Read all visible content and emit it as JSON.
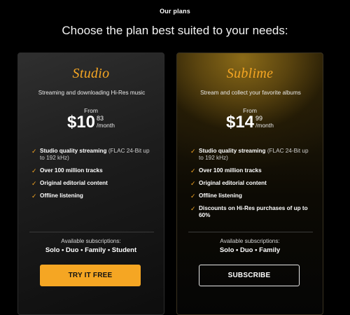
{
  "header": {
    "eyebrow": "Our plans",
    "headline": "Choose the plan best suited to your needs:"
  },
  "plans": [
    {
      "name": "Studio",
      "description": "Streaming and downloading Hi-Res music",
      "from_label": "From",
      "price_currency": "$",
      "price_whole": "$10",
      "price_cents": "83",
      "price_period": "/month",
      "features": [
        {
          "bold": "Studio quality streaming",
          "detail": " (FLAC 24-Bit up to 192 kHz)"
        },
        {
          "bold": "Over 100 million tracks",
          "detail": ""
        },
        {
          "bold": "Original editorial content",
          "detail": ""
        },
        {
          "bold": "Offline listening",
          "detail": ""
        }
      ],
      "available_label": "Available subscriptions:",
      "subscriptions": "Solo • Duo • Family • Student",
      "cta_label": "TRY IT FREE"
    },
    {
      "name": "Sublime",
      "description": "Stream and collect your favorite albums",
      "from_label": "From",
      "price_currency": "$",
      "price_whole": "$14",
      "price_cents": "99",
      "price_period": "/month",
      "features": [
        {
          "bold": "Studio quality streaming",
          "detail": " (FLAC 24-Bit up to 192 kHz)"
        },
        {
          "bold": "Over 100 million tracks",
          "detail": ""
        },
        {
          "bold": "Original editorial content",
          "detail": ""
        },
        {
          "bold": "Offline listening",
          "detail": ""
        },
        {
          "bold": "Discounts on Hi-Res purchases of up to 60%",
          "detail": ""
        }
      ],
      "available_label": "Available subscriptions:",
      "subscriptions": "Solo • Duo • Family",
      "cta_label": "SUBSCRIBE"
    }
  ],
  "icons": {
    "feature_check": "check-icon"
  },
  "colors": {
    "accent": "#f5a623",
    "background": "#000000"
  }
}
